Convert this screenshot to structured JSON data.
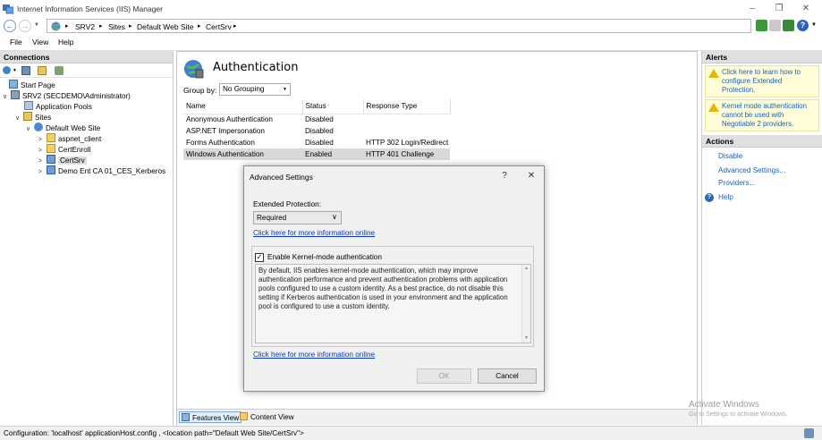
{
  "window": {
    "title": "Internet Information Services (IIS) Manager",
    "minimize": "–",
    "restore": "❐",
    "close": "✕"
  },
  "address": {
    "crumbs": [
      "SRV2",
      "Sites",
      "Default Web Site",
      "CertSrv"
    ],
    "separator": "▸"
  },
  "menu": [
    "File",
    "View",
    "Help"
  ],
  "connections": {
    "header": "Connections",
    "tree": [
      {
        "label": "Start Page"
      },
      {
        "label": "SRV2 (SECDEMO\\Administrator)"
      },
      {
        "label": "Application Pools"
      },
      {
        "label": "Sites"
      },
      {
        "label": "Default Web Site"
      },
      {
        "label": "aspnet_client"
      },
      {
        "label": "CertEnroll"
      },
      {
        "label": "CertSrv"
      },
      {
        "label": "Demo Ent CA 01_CES_Kerberos"
      }
    ]
  },
  "feature": {
    "title": "Authentication",
    "group_by_label": "Group by:",
    "group_by_value": "No Grouping",
    "columns": [
      "Name",
      "Status",
      "Response Type"
    ],
    "rows": [
      {
        "name": "Anonymous Authentication",
        "status": "Disabled",
        "response": ""
      },
      {
        "name": "ASP.NET Impersonation",
        "status": "Disabled",
        "response": ""
      },
      {
        "name": "Forms Authentication",
        "status": "Disabled",
        "response": "HTTP 302 Login/Redirect"
      },
      {
        "name": "Windows Authentication",
        "status": "Enabled",
        "response": "HTTP 401 Challenge"
      }
    ],
    "tabs": [
      "Features View",
      "Content View"
    ]
  },
  "actions": {
    "alerts_header": "Alerts",
    "alerts": [
      "Click here to learn how to configure Extended Protection.",
      "Kernel mode authentication cannot be used with Negotiable 2  providers."
    ],
    "actions_header": "Actions",
    "links": [
      "Disable",
      "Advanced Settings...",
      "Providers...",
      "Help"
    ]
  },
  "dialog": {
    "title": "Advanced Settings",
    "help": "?",
    "close": "✕",
    "extended_protection_label": "Extended Protection:",
    "extended_protection_value": "Required",
    "more_info_link_1": "Click here for more information online",
    "kernel_mode_label": "Enable Kernel-mode authentication",
    "kernel_mode_checked": "✓",
    "description": "By default, IIS enables kernel-mode authentication, which may improve authentication performance and prevent authentication problems with application pools configured to use a custom identity. As a best practice, do not disable this setting if Kerberos authentication is used in your environment and the application pool is configured to use a custom identity.",
    "more_info_link_2": "Click here for more information online",
    "ok_label": "OK",
    "cancel_label": "Cancel"
  },
  "watermark": {
    "line1": "Activate Windows",
    "line2": "Go to Settings to activate Windows."
  },
  "status_bar": "Configuration: 'localhost' applicationHost.config , <location path=\"Default Web Site/CertSrv\">",
  "colors": {
    "accent": "#1d5fb4",
    "link": "#0a37c6",
    "alert_bg": "#fffed8",
    "selected_row": "#d9d9d9"
  }
}
